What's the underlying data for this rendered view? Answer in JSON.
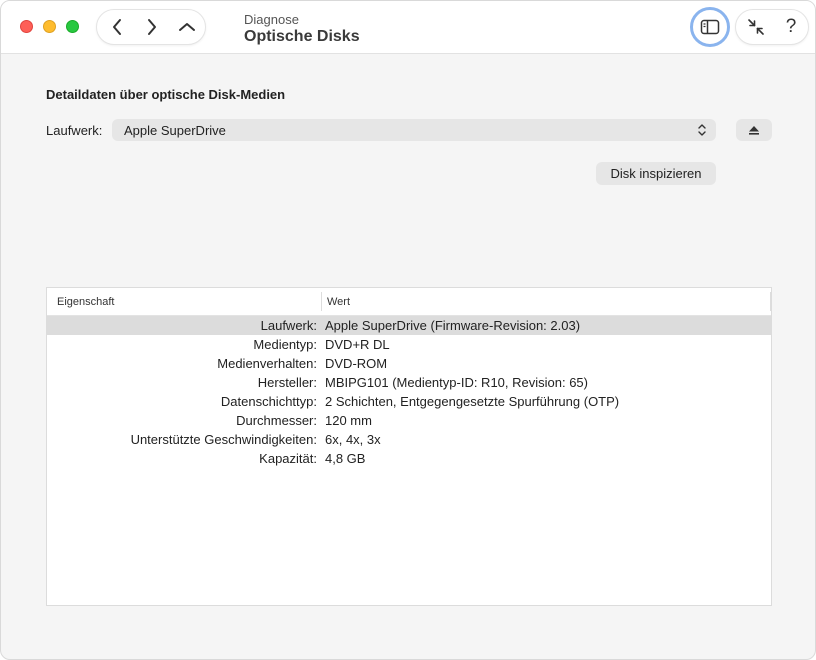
{
  "header": {
    "subtitle": "Diagnose",
    "title": "Optische Disks"
  },
  "toolbar": {
    "help_label": "?"
  },
  "main": {
    "heading": "Detaildaten über optische Disk-Medien",
    "drive_label": "Laufwerk:",
    "drive_value": "Apple SuperDrive",
    "inspect_button": "Disk inspizieren"
  },
  "table": {
    "columns": [
      "Eigenschaft",
      "Wert"
    ],
    "rows": [
      {
        "key": "Laufwerk:",
        "value": "Apple SuperDrive (Firmware-Revision: 2.03)"
      },
      {
        "key": "Medientyp:",
        "value": "DVD+R DL"
      },
      {
        "key": "Medienverhalten:",
        "value": "DVD-ROM"
      },
      {
        "key": "Hersteller:",
        "value": "MBIPG101 (Medientyp-ID: R10, Revision: 65)"
      },
      {
        "key": "Datenschichttyp:",
        "value": "2 Schichten, Entgegengesetzte Spurführung (OTP)"
      },
      {
        "key": "Durchmesser:",
        "value": "120 mm"
      },
      {
        "key": "Unterstützte Geschwindigkeiten:",
        "value": "6x, 4x, 3x"
      },
      {
        "key": "Kapazität:",
        "value": "4,8 GB"
      }
    ]
  },
  "icons": {
    "back": "chevron-left-icon",
    "forward": "chevron-right-icon",
    "up": "chevron-up-icon",
    "sidebar": "sidebar-icon",
    "shrink": "arrows-inward-icon",
    "eject": "eject-icon",
    "select": "chevron-updown-icon"
  },
  "colors": {
    "close": "#fe5f57",
    "minimize": "#febc2e",
    "maximize": "#28c840",
    "focus_ring": "#8ab4ee",
    "selected_row": "#dcdcdc"
  }
}
